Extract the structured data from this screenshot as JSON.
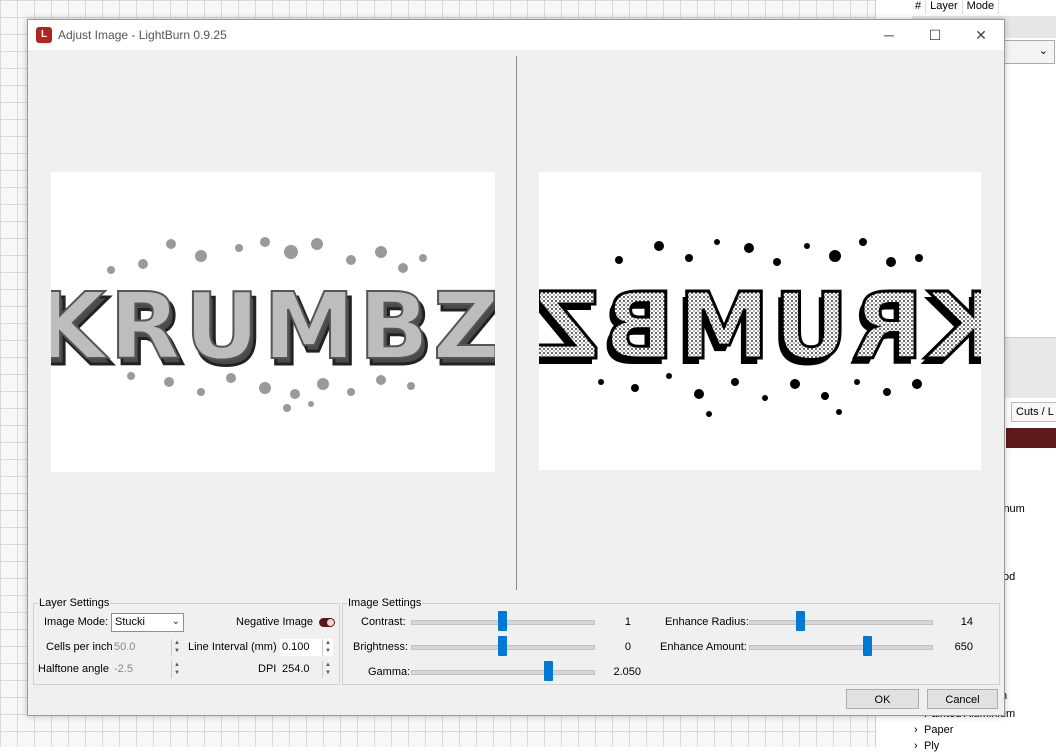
{
  "window": {
    "title": "Adjust Image - LightBurn 0.9.25",
    "icon": "lightburn-logo-icon"
  },
  "preview": {
    "original_text": "KRUMBZ",
    "processed_text": "KRUMBZ"
  },
  "layer_settings": {
    "title": "Layer Settings",
    "image_mode_label": "Image Mode:",
    "image_mode_value": "Stucki",
    "negative_image_label": "Negative Image",
    "cells_per_inch_label": "Cells per inch",
    "cells_per_inch_value": "50.0",
    "line_interval_label": "Line Interval (mm)",
    "line_interval_value": "0.100",
    "halftone_angle_label": "Halftone angle",
    "halftone_angle_value": "-2.5",
    "dpi_label": "DPI",
    "dpi_value": "254.0"
  },
  "image_settings": {
    "title": "Image Settings",
    "contrast": {
      "label": "Contrast:",
      "value": "1",
      "level": 0.5
    },
    "brightness": {
      "label": "Brightness:",
      "value": "0",
      "level": 0.5
    },
    "gamma": {
      "label": "Gamma:",
      "value": "2.050",
      "level": 0.75
    },
    "enhance_radius": {
      "label": "Enhance Radius:",
      "value": "14",
      "level": 0.28
    },
    "enhance_amount": {
      "label": "Enhance Amount:",
      "value": "650",
      "level": 0.65
    }
  },
  "buttons": {
    "ok": "OK",
    "cancel": "Cancel"
  },
  "right_panel": {
    "col_hash": "#",
    "col_layer": "Layer",
    "col_mode": "Mode",
    "mode_partial": "ge",
    "cuts_tab": "Cuts / L",
    "material_partial_1": "inum",
    "material_partial_2": "od",
    "material_partial_3": "n",
    "material_painted": "Painted Aluminium",
    "material_paper": "Paper",
    "material_ply": "Ply"
  },
  "colors": {
    "accent": "#0078d7",
    "brand": "#b3241f",
    "toggle": "#5b1818"
  }
}
